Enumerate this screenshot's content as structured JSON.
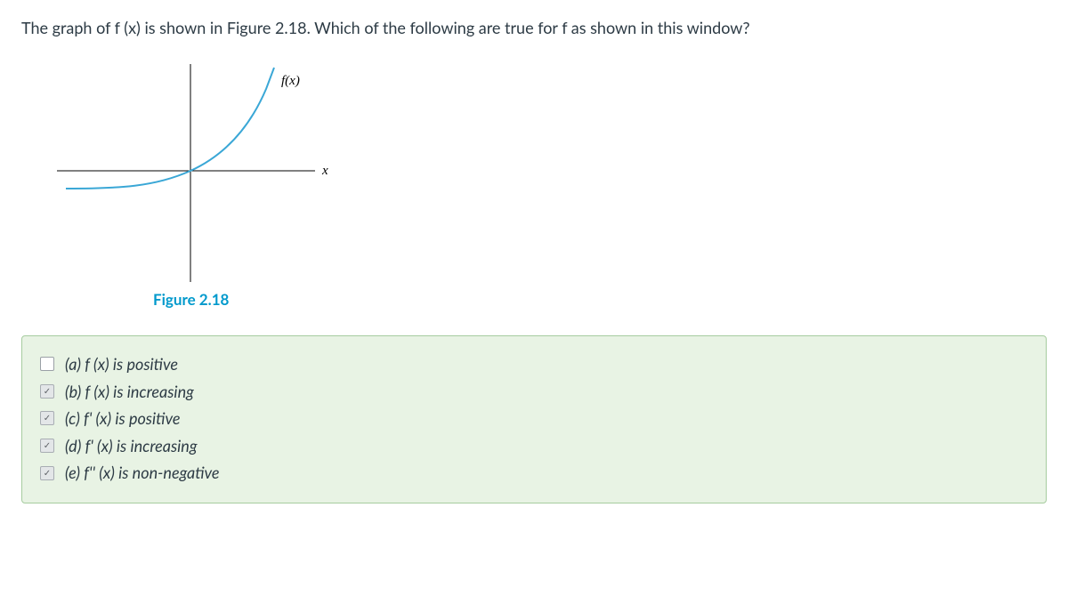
{
  "question": "The graph of f (x) is shown in Figure 2.18. Which of the following are true for f as shown in this window?",
  "figure": {
    "function_label": "f(x)",
    "axis_label": "x",
    "caption": "Figure 2.18"
  },
  "options": [
    {
      "key": "a",
      "label": "(a) f (x) is positive",
      "checked": false
    },
    {
      "key": "b",
      "label": "(b) f (x) is increasing",
      "checked": true
    },
    {
      "key": "c",
      "label": "(c) f' (x) is positive",
      "checked": true
    },
    {
      "key": "d",
      "label": "(d) f' (x) is increasing",
      "checked": true
    },
    {
      "key": "e",
      "label": "(e) f'' (x) is non-negative",
      "checked": true
    }
  ],
  "chart_data": {
    "type": "line",
    "title": "",
    "xlabel": "x",
    "ylabel": "f(x)",
    "xlim": [
      -3,
      3
    ],
    "ylim": [
      -3,
      3
    ],
    "series": [
      {
        "name": "f(x)",
        "x": [
          -3.0,
          -2.5,
          -2.0,
          -1.5,
          -1.0,
          -0.5,
          0.0,
          0.5,
          1.0,
          1.3,
          1.6,
          1.8,
          1.9
        ],
        "y": [
          -0.5,
          -0.48,
          -0.45,
          -0.4,
          -0.32,
          -0.2,
          0.0,
          0.3,
          0.8,
          1.4,
          2.1,
          2.7,
          3.0
        ]
      }
    ]
  }
}
